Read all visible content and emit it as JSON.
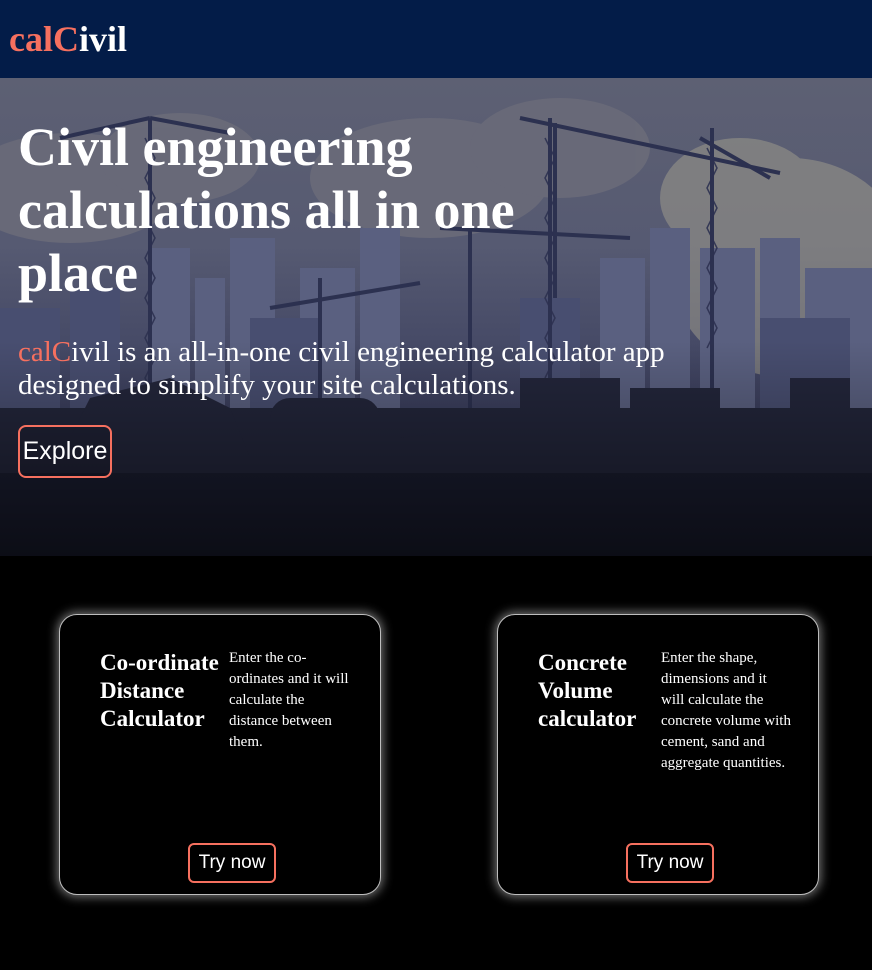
{
  "brand": {
    "logo_accent": "calC",
    "logo_rest": "ivil",
    "accent_color": "#f6705f",
    "nav_color": "#031c48"
  },
  "hero": {
    "title": "Civil engineering calculations all in one place",
    "text_accent": "calC",
    "text_brand_rest": "ivil",
    "text_body": " is an all-in-one civil engineering calculator app designed to simplify your site calculations.",
    "explore_label": "Explore"
  },
  "cards": [
    {
      "title": "Co-ordinate Distance Calculator",
      "description": "Enter the co-ordinates and it will calculate the distance between them.",
      "button_label": "Try now"
    },
    {
      "title": "Concrete Volume calculator",
      "description": "Enter the shape, dimensions and it will calculate the concrete volume with cement, sand and aggregate quantities.",
      "button_label": "Try now"
    }
  ]
}
